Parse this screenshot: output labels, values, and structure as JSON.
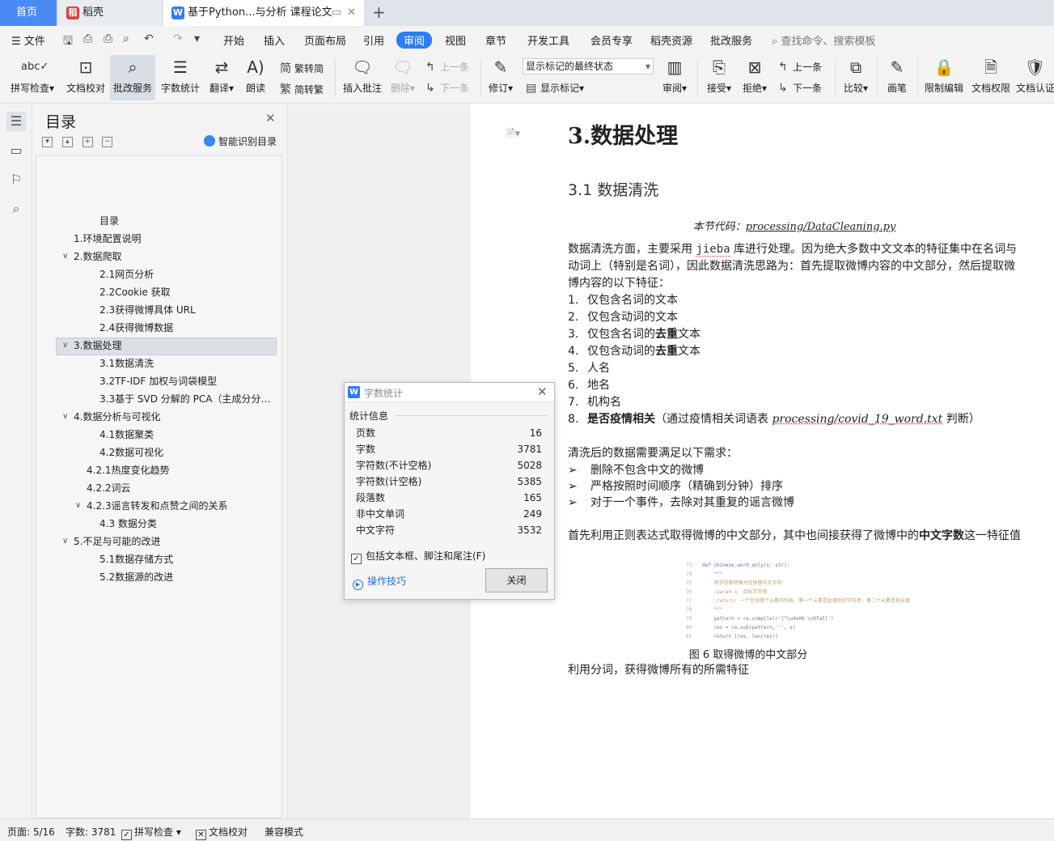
{
  "tabs": {
    "home": "首页",
    "daoke": "稻壳",
    "document": "基于Python...与分析 课程论文"
  },
  "menubar": {
    "file": "文件",
    "tabs": [
      "开始",
      "插入",
      "页面布局",
      "引用",
      "审阅",
      "视图",
      "章节",
      "开发工具",
      "会员专享",
      "稻壳资源",
      "批改服务"
    ],
    "active_tab": "审阅",
    "search": "查找命令、搜索模板"
  },
  "ribbon": {
    "spell_check": "拼写检查",
    "doc_proofread": "文档校对",
    "correction_service": "批改服务",
    "word_count": "字数统计",
    "translate": "翻译",
    "read_aloud": "朗读",
    "trad_to_simp": "繁转简",
    "simp_to_trad": "简转繁",
    "insert_comment": "插入批注",
    "delete": "删除",
    "prev_comment": "上一条",
    "next_comment": "下一条",
    "revise": "修订",
    "markup_select": "显示标记的最终状态",
    "show_markup": "显示标记",
    "review": "审阅",
    "accept": "接受",
    "reject": "拒绝",
    "prev_change": "上一条",
    "next_change": "下一条",
    "compare": "比较",
    "pen": "画笔",
    "restrict_edit": "限制编辑",
    "doc_permission": "文档权限",
    "doc_auth": "文档认证"
  },
  "toc": {
    "title": "目录",
    "smart": "智能识别目录",
    "items": [
      {
        "label": "目录",
        "level": 3
      },
      {
        "label": "1.环境配置说明",
        "level": 1
      },
      {
        "label": "2.数据爬取",
        "level": 1,
        "expanded": true
      },
      {
        "label": "2.1网页分析",
        "level": 3
      },
      {
        "label": "2.2Cookie 获取",
        "level": 3
      },
      {
        "label": "2.3获得微博具体 URL",
        "level": 3
      },
      {
        "label": "2.4获得微博数据",
        "level": 3
      },
      {
        "label": "3.数据处理",
        "level": 1,
        "expanded": true,
        "selected": true
      },
      {
        "label": "3.1数据清洗",
        "level": 3
      },
      {
        "label": "3.2TF-IDF 加权与词袋模型",
        "level": 3
      },
      {
        "label": "3.3基于 SVD 分解的 PCA（主成分分…",
        "level": 3
      },
      {
        "label": "4.数据分析与可视化",
        "level": 1,
        "expanded": true
      },
      {
        "label": "4.1数据聚类",
        "level": 3
      },
      {
        "label": "4.2数据可视化",
        "level": 3
      },
      {
        "label": "4.2.1热度变化趋势",
        "level": 2
      },
      {
        "label": "4.2.2词云",
        "level": 2
      },
      {
        "label": "4.2.3谣言转发和点赞之间的关系",
        "level": 2,
        "expanded": true
      },
      {
        "label": "4.3 数据分类",
        "level": 3
      },
      {
        "label": "5.不足与可能的改进",
        "level": 1,
        "expanded": true
      },
      {
        "label": "5.1数据存储方式",
        "level": 3
      },
      {
        "label": "5.2数据源的改进",
        "level": 3
      }
    ]
  },
  "document": {
    "h1": "3.数据处理",
    "h2": "3.1  数据清洗",
    "code_ref_prefix": "本节代码：",
    "code_ref_file": "processing/DataCleaning.py",
    "para1_a": "数据清洗方面，主要采用 ",
    "para1_lib": "jieba",
    "para1_b": " 库进行处理。因为绝大多数中文文本的特征集中在名词与动词上（特别是名词），因此数据清洗思路为：首先提取微博内容的中文部分，然后提取微博内容的以下特征：",
    "features": [
      {
        "num": "1.",
        "a": "仅包含名词的文本",
        "bold": "",
        "b": ""
      },
      {
        "num": "2.",
        "a": "仅包含动词的文本",
        "bold": "",
        "b": ""
      },
      {
        "num": "3.",
        "a": "仅包含名词的",
        "bold": "去重",
        "b": "文本"
      },
      {
        "num": "4.",
        "a": "仅包含动词的",
        "bold": "去重",
        "b": "文本"
      },
      {
        "num": "5.",
        "a": "人名",
        "bold": "",
        "b": ""
      },
      {
        "num": "6.",
        "a": "地名",
        "bold": "",
        "b": ""
      },
      {
        "num": "7.",
        "a": "机构名",
        "bold": "",
        "b": ""
      }
    ],
    "feature8_num": "8.",
    "feature8_bold": "是否疫情相关",
    "feature8_a": "（通过疫情相关词语表 ",
    "feature8_file": "processing/covid_19_word.txt",
    "feature8_b": " 判断）",
    "para2": "清洗后的数据需要满足以下需求：",
    "requirements": [
      "删除不包含中文的微博",
      "严格按照时间顺序（精确到分钟）排序",
      "对于一个事件，去除对其重复的谣言微博"
    ],
    "para3_a": "首先利用正则表达式取得微博的中文部分，其中也间接获得了微博中的",
    "para3_bold": "中文字数",
    "para3_b": "这一特征值",
    "code_lines": [
      {
        "n": "73",
        "t": "def chinese_word_only(s: str):"
      },
      {
        "n": "74",
        "t": "    \"\"\""
      },
      {
        "n": "75",
        "t": "    将字符串转换为仅保留中文字符"
      },
      {
        "n": "76",
        "t": "    :param s: 目标字符串"
      },
      {
        "n": "77",
        "t": "    :return: 一个包含两个元素的列表，第一个元素是处理后的字符串，第二个元素是其长度"
      },
      {
        "n": "78",
        "t": "    \"\"\""
      },
      {
        "n": "79",
        "t": "    pattern = re.compile(r'[^\\u4e00-\\u9fa5]')"
      },
      {
        "n": "80",
        "t": "    res = re.sub(pattern, '', s)"
      },
      {
        "n": "81",
        "t": "    return [res, len(res)]"
      }
    ],
    "caption": "图 6 取得微博的中文部分",
    "para4": "利用分词，获得微博所有的所需特征"
  },
  "dialog": {
    "title": "字数统计",
    "section": "统计信息",
    "rows": [
      {
        "label": "页数",
        "value": "16"
      },
      {
        "label": "字数",
        "value": "3781"
      },
      {
        "label": "字符数(不计空格)",
        "value": "5028"
      },
      {
        "label": "字符数(计空格)",
        "value": "5385"
      },
      {
        "label": "段落数",
        "value": "165"
      },
      {
        "label": "非中文单词",
        "value": "249"
      },
      {
        "label": "中文字符",
        "value": "3532"
      }
    ],
    "include_label": "包括文本框、脚注和尾注(F)",
    "include_checked": true,
    "tips": "操作技巧",
    "close": "关闭"
  },
  "status": {
    "page": "页面: 5/16",
    "words": "字数: 3781",
    "spell": "拼写检查",
    "proofread": "文档校对",
    "compat": "兼容模式"
  },
  "colors": {
    "accent": "#2e7cf6",
    "home_tab": "#4a8af4",
    "link": "#2e6fd8"
  }
}
